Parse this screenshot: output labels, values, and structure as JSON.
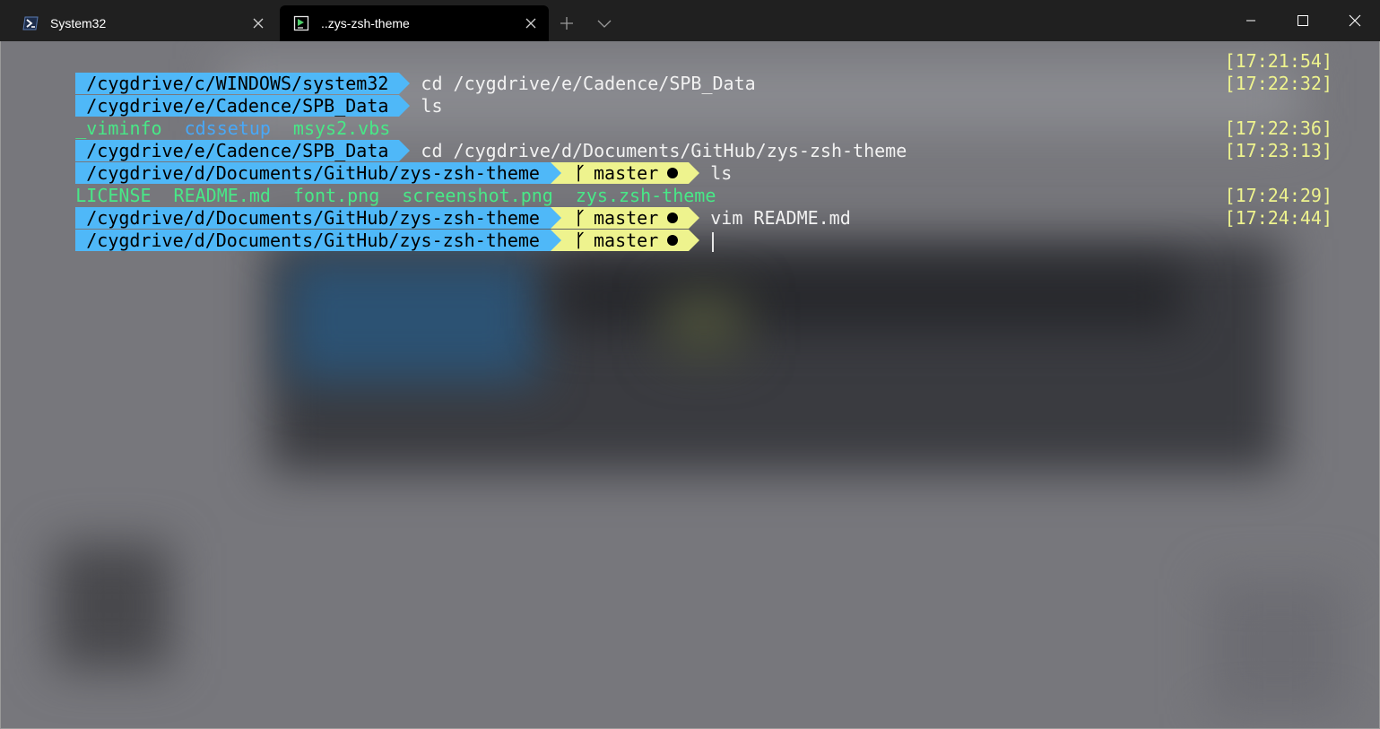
{
  "window": {
    "tabs": [
      {
        "title": "System32",
        "icon": "powershell-icon",
        "active": false
      },
      {
        "title": "..zys-zsh-theme",
        "icon": "terminal-icon",
        "active": true
      }
    ]
  },
  "colors": {
    "path_bg": "#4fb8f8",
    "git_bg": "#eef38e",
    "timestamp": "#eef38e",
    "file_green": "#48e887",
    "file_blue": "#48a8f8",
    "command": "#f2f2f2"
  },
  "terminal": {
    "lines": [
      {
        "path": "/cygdrive/c/WINDOWS/system32",
        "command": "cd /cygdrive/e/Cadence/SPB_Data",
        "time": "[17:21:54]"
      },
      {
        "path": "/cygdrive/e/Cadence/SPB_Data",
        "command": "ls",
        "time": "[17:22:32]"
      },
      {
        "output": [
          "_viminfo",
          "cdssetup",
          "msys2.vbs"
        ]
      },
      {
        "path": "/cygdrive/e/Cadence/SPB_Data",
        "command": "cd /cygdrive/d/Documents/GitHub/zys-zsh-theme",
        "time": "[17:22:36]"
      },
      {
        "path": "/cygdrive/d/Documents/GitHub/zys-zsh-theme",
        "branch": "master",
        "command": "ls",
        "time": "[17:23:13]"
      },
      {
        "output": [
          "LICENSE",
          "README.md",
          "font.png",
          "screenshot.png",
          "zys.zsh-theme"
        ]
      },
      {
        "path": "/cygdrive/d/Documents/GitHub/zys-zsh-theme",
        "branch": "master",
        "command": "vim README.md",
        "time": "[17:24:29]"
      },
      {
        "path": "/cygdrive/d/Documents/GitHub/zys-zsh-theme",
        "branch": "master",
        "command": "",
        "time": "[17:24:44]"
      }
    ]
  }
}
